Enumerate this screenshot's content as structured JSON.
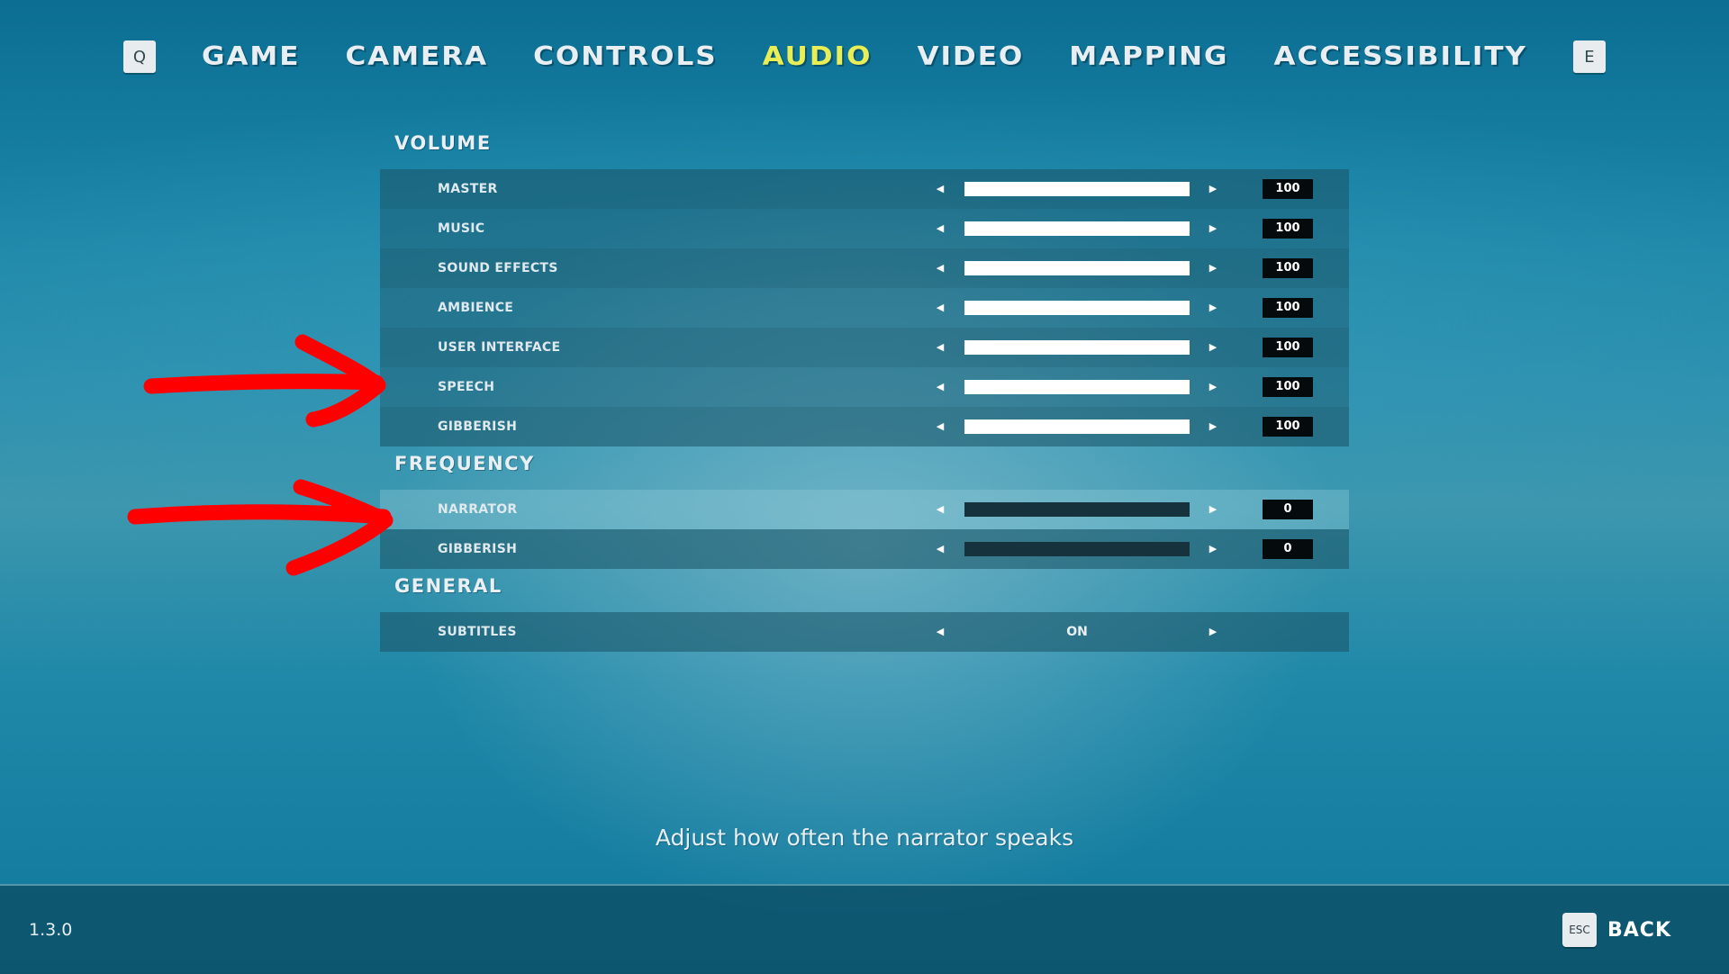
{
  "nav": {
    "prev_key": "Q",
    "next_key": "E",
    "tabs": [
      {
        "label": "GAME",
        "active": false
      },
      {
        "label": "CAMERA",
        "active": false
      },
      {
        "label": "CONTROLS",
        "active": false
      },
      {
        "label": "AUDIO",
        "active": true
      },
      {
        "label": "VIDEO",
        "active": false
      },
      {
        "label": "MAPPING",
        "active": false
      },
      {
        "label": "ACCESSIBILITY",
        "active": false
      }
    ]
  },
  "sections": {
    "volume": {
      "title": "VOLUME",
      "rows": [
        {
          "label": "MASTER",
          "value": "100",
          "level": 100
        },
        {
          "label": "MUSIC",
          "value": "100",
          "level": 100
        },
        {
          "label": "SOUND EFFECTS",
          "value": "100",
          "level": 100
        },
        {
          "label": "AMBIENCE",
          "value": "100",
          "level": 100
        },
        {
          "label": "USER INTERFACE",
          "value": "100",
          "level": 100
        },
        {
          "label": "SPEECH",
          "value": "100",
          "level": 100
        },
        {
          "label": "GIBBERISH",
          "value": "100",
          "level": 100
        }
      ]
    },
    "frequency": {
      "title": "FREQUENCY",
      "rows": [
        {
          "label": "NARRATOR",
          "value": "0",
          "level": 0
        },
        {
          "label": "GIBBERISH",
          "value": "0",
          "level": 0
        }
      ]
    },
    "general": {
      "title": "GENERAL",
      "rows": [
        {
          "label": "SUBTITLES",
          "value": "ON"
        }
      ]
    }
  },
  "description": "Adjust how often the narrator speaks",
  "footer": {
    "version": "1.3.0",
    "back_key": "ESC",
    "back_label": "BACK"
  },
  "colors": {
    "active_tab": "#e8ee55",
    "annotation_arrow": "#ff0000"
  }
}
